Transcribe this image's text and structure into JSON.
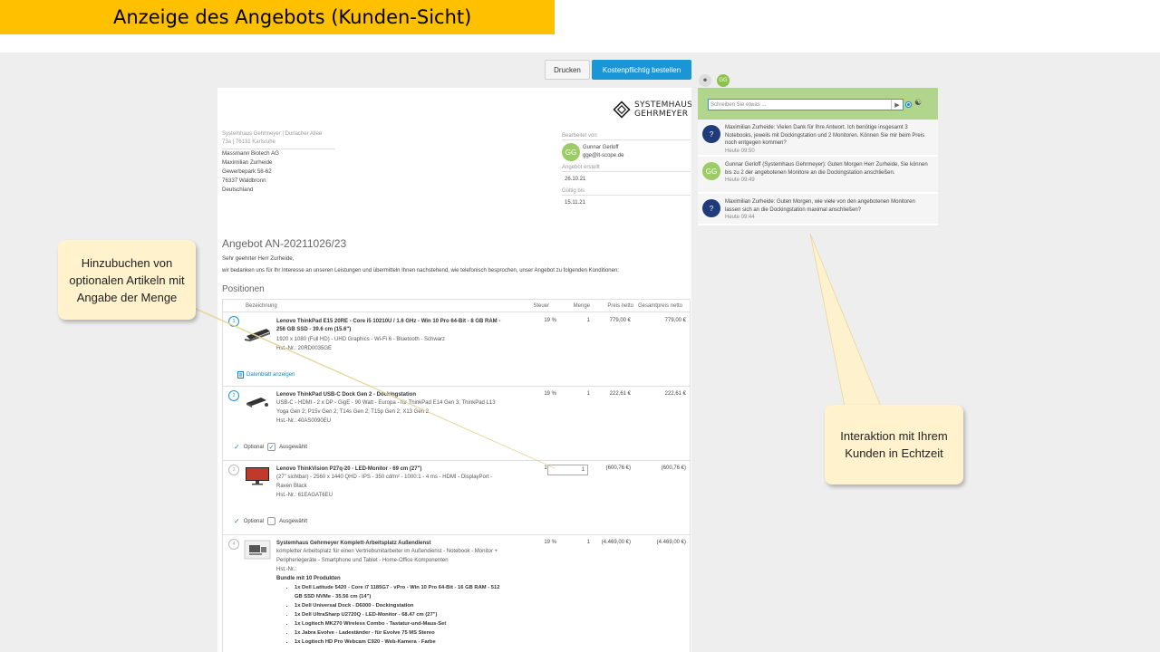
{
  "slide": {
    "title": "Anzeige des Angebots (Kunden-Sicht)"
  },
  "toolbar": {
    "print_label": "Drucken",
    "order_label": "Kostenpflichtig bestellen",
    "user_initials": "GG"
  },
  "document": {
    "logo_line1": "SYSTEMHAUS",
    "logo_line2": "GEHRMEYER",
    "sender_line1": "Systemhaus Gehrmeyer | Durlacher Allee",
    "sender_line2": "73a | 76131 Karlsruhe",
    "recipient": [
      "Massmann Biotech AG",
      "Maximilian Zurheide",
      "Gewerbepark 58-62",
      "76337 Waldbronn",
      "Deutschland"
    ],
    "edited_by_label": "Bearbeitet von",
    "editor_initials": "GG",
    "editor_name": "Gunnar Gerloff",
    "editor_email": "gge@it-scope.de",
    "created_label": "Angebot erstellt",
    "created_date": "26.10.21",
    "valid_label": "Gültig bis",
    "valid_date": "15.11.21",
    "offer_title": "Angebot AN-20211026/23",
    "greeting": "Sehr geehrter Herr Zurheide,",
    "intro": "wir bedanken uns für Ihr Interesse an unseren Leistungen und übermitteln Ihnen nachstehend, wie telefonisch besprochen, unser Angebot zu folgenden Konditionen:",
    "positions_heading": "Positionen",
    "columns": {
      "desc": "Bezeichnung",
      "tax": "Steuer",
      "qty": "Menge",
      "net": "Preis netto",
      "total": "Gesamtpreis netto"
    },
    "datasheet_label": "Datenblatt anzeigen",
    "optional_label": "Optional",
    "selected_label": "Ausgewählt",
    "items": [
      {
        "num": "1",
        "name": "Lenovo ThinkPad E15 20RE - Core i5 10210U / 1.6 GHz - Win 10 Pro 64-Bit - 8 GB RAM - 256 GB SSD - 39.6 cm (15.6\")",
        "desc1": "1920 x 1080 (Full HD) - UHD Graphics - Wi-Fi 6 - Bluetooth - Schwarz",
        "desc2": "Hst.-Nr.: 20RD0035GE",
        "tax": "19 %",
        "qty": "1",
        "net": "779,00 €",
        "total": "779,00 €"
      },
      {
        "num": "2",
        "name": "Lenovo ThinkPad USB-C Dock Gen 2 - Dockingstation",
        "desc1": "USB-C - HDMI - 2 x DP - GigE - 90 Watt - Europa - für ThinkPad E14 Gen 3; ThinkPad L13 Yoga Gen 2; P15v Gen 2; T14s Gen 2; T15p Gen 2; X13 Gen 2",
        "desc2": "Hst.-Nr.: 40AS0090EU",
        "tax": "19 %",
        "qty": "1",
        "net": "222,61 €",
        "total": "222,61 €"
      },
      {
        "num": "3",
        "name": "Lenovo ThinkVision P27q-20 - LED-Monitor - 69 cm (27\")",
        "desc1": "(27\" sichtbar) - 2560 x 1440 QHD - IPS - 350 cd/m² - 1000:1 - 4 ms - HDMI - DisplayPort - Raven Black",
        "desc2": "Hst.-Nr.: 61EAGAT6EU",
        "tax": "19 %",
        "qty": "1",
        "net": "(600,76 €)",
        "total": "(600,76 €)"
      },
      {
        "num": "4",
        "name": "Systemhaus Gehrmeyer Komplett-Arbeitsplatz Außendienst",
        "desc1": "kompletter Arbeitsplatz für einen Vertriebsmitarbeiter im Außendienst - Notebook - Monitor + Peripheriegeräte - Smartphone und Tablet - Home-Office Komponenten",
        "desc2": "Hst.-Nr.:",
        "tax": "19 %",
        "qty": "1",
        "net": "(4.469,00 €)",
        "total": "(4.469,00 €)"
      }
    ],
    "bundle_heading": "Bundle mit 10 Produkten",
    "bundle_items": [
      "1x Dell Latitude 5420 - Core i7 1185G7 - vPro - Win 10 Pro 64-Bit - 16 GB RAM - 512 GB SSD NVMe - 35.56 cm (14\")",
      "1x Dell Universal Dock - D6000 - Dockingstation",
      "1x Dell UltraSharp U2720Q - LED-Monitor - 68.47 cm (27\")",
      "1x Logitech MK270 Wireless Combo - Tastatur-und-Maus-Set",
      "1x Jabra Evolve - Ladeständer - für Evolve 75 MS Stereo",
      "1x Logitech HD Pro Webcam C920 - Web-Kamera - Farbe"
    ]
  },
  "chat": {
    "placeholder": "Schreiben Sie etwas ...",
    "messages": [
      {
        "avatar": "?",
        "text": "Maximilian Zurheide: Vielen Dank für Ihre Antwort. Ich benötige insgesamt 3 Notebooks, jeweils mit Dockingstation und 2 Monitoren. Können Sie mir beim Preis noch entgegen kommen?",
        "time": "Heute 09:50"
      },
      {
        "avatar": "GG",
        "text": "Gunnar Gerloff (Systemhaus Gehrmeyer): Guten Morgen Herr Zurheide, Sie können bis zu 2 der angebotenen Monitore an die Dockingstation anschließen.",
        "time": "Heute 09:49"
      },
      {
        "avatar": "?",
        "text": "Maximilian Zurheide: Guten Morgen, wie viele von den angebotenen Monitoren lassen sich an die Dockingstation maximal anschließen?",
        "time": "Heute 09:44"
      }
    ]
  },
  "callouts": {
    "left": "Hinzubuchen von optionalen Artikeln mit Angabe der Menge",
    "right": "Interaktion mit Ihrem Kunden in Echtzeit"
  },
  "colors": {
    "title_bar": "#ffc000",
    "accent": "#1a95d6",
    "callout_bg": "#fff2cc",
    "chat_bar": "#b2d58c"
  }
}
